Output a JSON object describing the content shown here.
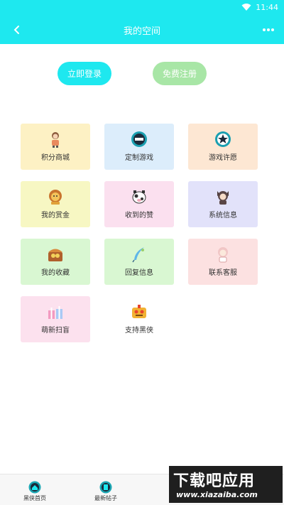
{
  "status_bar": {
    "time": "11:44",
    "wifi_icon": "wifi-icon"
  },
  "header": {
    "title": "我的空间",
    "back_icon": "back-arrow-icon",
    "more_icon": "more-dots-icon"
  },
  "auth": {
    "login_label": "立即登录",
    "register_label": "免费注册"
  },
  "menu": [
    {
      "label": "积分商城",
      "icon": "character-icon",
      "bg": "#fdf1c4"
    },
    {
      "label": "定制游戏",
      "icon": "new-badge-icon",
      "bg": "#dcedfb"
    },
    {
      "label": "游戏许愿",
      "icon": "wish-icon",
      "bg": "#fde7d3"
    },
    {
      "label": "我的赏金",
      "icon": "lion-icon",
      "bg": "#f7f7c3"
    },
    {
      "label": "收到的赞",
      "icon": "cow-icon",
      "bg": "#fbe0ef"
    },
    {
      "label": "系统信息",
      "icon": "anime-girl-icon",
      "bg": "#e2e2fa"
    },
    {
      "label": "我的收藏",
      "icon": "treasure-box-icon",
      "bg": "#d9f7d2"
    },
    {
      "label": "回复信息",
      "icon": "feather-icon",
      "bg": "#d9f7d2"
    },
    {
      "label": "联系客服",
      "icon": "support-girl-icon",
      "bg": "#fce1e1"
    },
    {
      "label": "萌新扫盲",
      "icon": "gift-icon",
      "bg": "#fce1ee"
    },
    {
      "label": "支持黑侠",
      "icon": "support-icon",
      "bg": "#ffffff"
    }
  ],
  "bottom_nav": [
    {
      "label": "黑侠首页",
      "icon": "home-icon"
    },
    {
      "label": "最新帖子",
      "icon": "posts-icon"
    }
  ],
  "watermark": {
    "line1": "下载吧应用",
    "line2": "www.xiazaiba.com"
  },
  "colors": {
    "accent": "#1ee8ef",
    "register": "#a8e6a6"
  }
}
